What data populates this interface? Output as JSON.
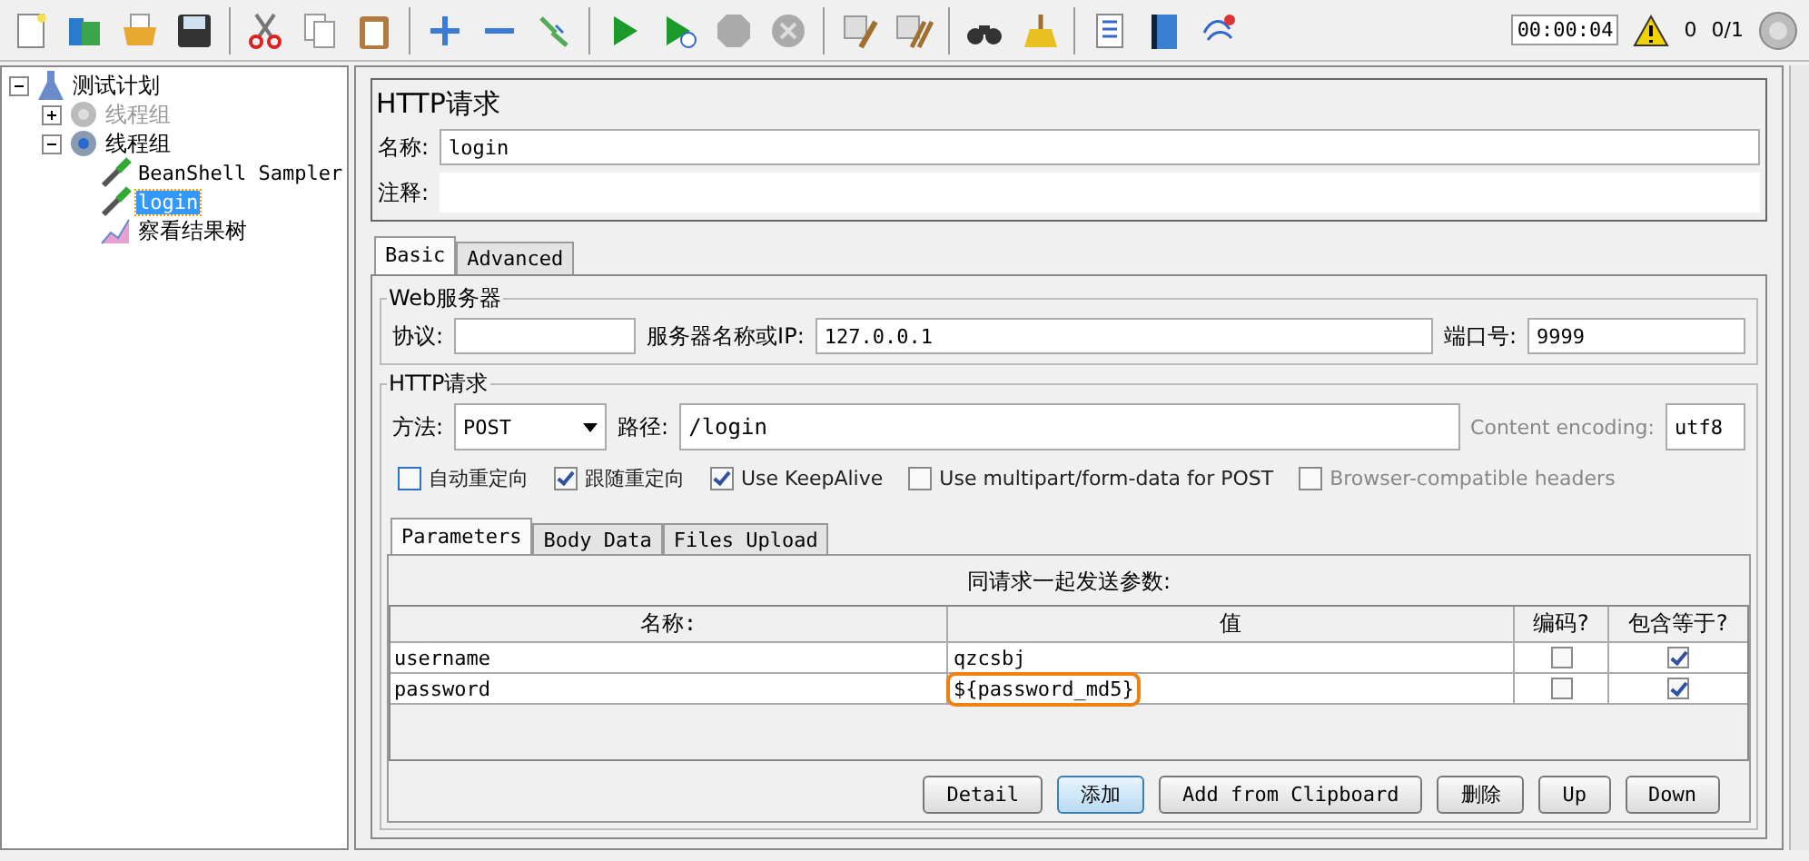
{
  "toolbar": {
    "timer": "00:00:04",
    "warnings": "0",
    "threads": "0/1"
  },
  "tree": [
    {
      "label": "测试计划",
      "kind": "plan",
      "expanded": true,
      "selected": false,
      "disabled": false,
      "children": [
        {
          "label": "线程组",
          "kind": "group",
          "expanded": false,
          "selected": false,
          "disabled": true
        },
        {
          "label": "线程组",
          "kind": "group",
          "expanded": true,
          "selected": false,
          "disabled": false,
          "children": [
            {
              "label": "BeanShell Sampler",
              "kind": "sampler",
              "selected": false,
              "disabled": false
            },
            {
              "label": "login",
              "kind": "sampler",
              "selected": true,
              "disabled": false
            },
            {
              "label": "察看结果树",
              "kind": "listener",
              "selected": false,
              "disabled": false
            }
          ]
        }
      ]
    }
  ],
  "panel": {
    "title": "HTTP请求",
    "name_label": "名称:",
    "name": "login",
    "comment_label": "注释:",
    "tabs": [
      {
        "label": "Basic",
        "selected": true
      },
      {
        "label": "Advanced",
        "selected": false
      }
    ],
    "web_server": {
      "legend": "Web服务器",
      "protocol_label": "协议:",
      "server_label": "服务器名称或IP:",
      "server": "127.0.0.1",
      "port_label": "端口号:",
      "port": "9999"
    },
    "request": {
      "legend": "HTTP请求",
      "method_label": "方法:",
      "method": "POST",
      "path_label": "路径:",
      "path": "/login",
      "encoding_label": "Content encoding:",
      "encoding": "utf8",
      "options": [
        {
          "label": "自动重定向",
          "checked": false,
          "disabled": false
        },
        {
          "label": "跟随重定向",
          "checked": true,
          "disabled": false
        },
        {
          "label": "Use KeepAlive",
          "checked": true,
          "disabled": false
        },
        {
          "label": "Use multipart/form-data for POST",
          "checked": false,
          "disabled": false
        },
        {
          "label": "Browser-compatible headers",
          "checked": false,
          "disabled": true
        }
      ],
      "tabs": [
        {
          "label": "Parameters",
          "selected": true
        },
        {
          "label": "Body Data",
          "selected": false
        },
        {
          "label": "Files Upload",
          "selected": false
        }
      ],
      "caption": "同请求一起发送参数:",
      "columns": [
        "名称:",
        "值",
        "编码?",
        "包含等于?"
      ],
      "rows": [
        {
          "name": "username",
          "value": "qzcsbj",
          "encode": false,
          "include_equals": true,
          "highlighted": false
        },
        {
          "name": "password",
          "value": "${password_md5}",
          "encode": false,
          "include_equals": true,
          "highlighted": true
        }
      ],
      "buttons": [
        {
          "label": "Detail",
          "selected": false
        },
        {
          "label": "添加",
          "selected": true
        },
        {
          "label": "Add from Clipboard",
          "selected": false
        },
        {
          "label": "删除",
          "selected": false
        },
        {
          "label": "Up",
          "selected": false
        },
        {
          "label": "Down",
          "selected": false
        }
      ]
    }
  }
}
